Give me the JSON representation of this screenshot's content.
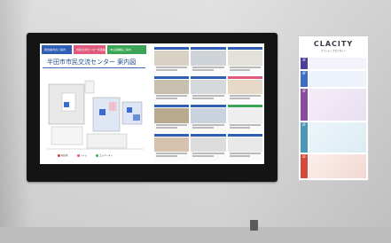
{
  "screen": {
    "tabs": [
      {
        "label": "総合案内のご案内",
        "color": "#2f5fb5"
      },
      {
        "label": "市民交流センター利用案内",
        "color": "#e15a7c"
      },
      {
        "label": "市立図書館ご案内",
        "color": "#3aa655"
      }
    ],
    "title": "半田市市民交流センター 案内図",
    "legend": [
      "現在地",
      "トイレ",
      "エレベーター"
    ]
  },
  "poster": {
    "brand": "CLACITY",
    "tagline": "クラシティ フロアガイド",
    "floors": [
      {
        "label": "3F",
        "color": "#4b3f9a"
      },
      {
        "label": "4F",
        "color": "#3c6fc4"
      },
      {
        "label": "3F",
        "color": "#8c4a9e"
      },
      {
        "label": "2F",
        "color": "#4a97b8"
      },
      {
        "label": "1F",
        "color": "#d64a3b"
      }
    ]
  },
  "colors": {
    "bezel": "#141414",
    "accent_blue": "#2f5fb5"
  }
}
